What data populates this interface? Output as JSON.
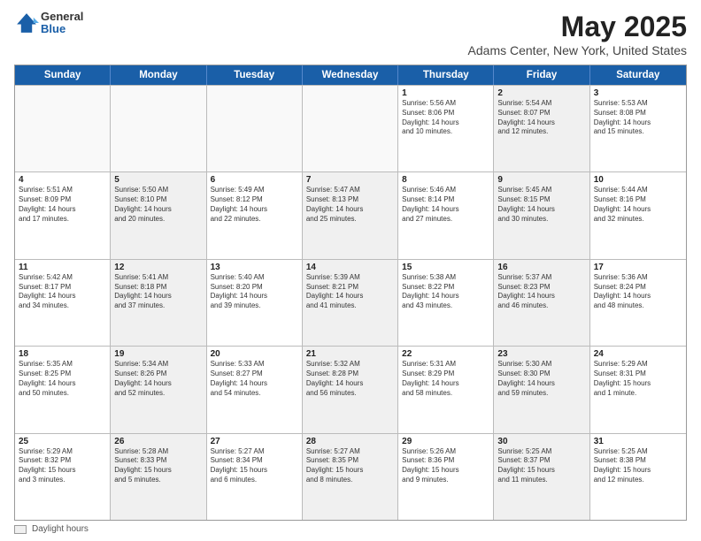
{
  "logo": {
    "general": "General",
    "blue": "Blue"
  },
  "title": "May 2025",
  "subtitle": "Adams Center, New York, United States",
  "days_of_week": [
    "Sunday",
    "Monday",
    "Tuesday",
    "Wednesday",
    "Thursday",
    "Friday",
    "Saturday"
  ],
  "weeks": [
    [
      {
        "day": "",
        "info": "",
        "empty": true
      },
      {
        "day": "",
        "info": "",
        "empty": true
      },
      {
        "day": "",
        "info": "",
        "empty": true
      },
      {
        "day": "",
        "info": "",
        "empty": true
      },
      {
        "day": "1",
        "info": "Sunrise: 5:56 AM\nSunset: 8:06 PM\nDaylight: 14 hours\nand 10 minutes."
      },
      {
        "day": "2",
        "info": "Sunrise: 5:54 AM\nSunset: 8:07 PM\nDaylight: 14 hours\nand 12 minutes.",
        "shaded": true
      },
      {
        "day": "3",
        "info": "Sunrise: 5:53 AM\nSunset: 8:08 PM\nDaylight: 14 hours\nand 15 minutes."
      }
    ],
    [
      {
        "day": "4",
        "info": "Sunrise: 5:51 AM\nSunset: 8:09 PM\nDaylight: 14 hours\nand 17 minutes."
      },
      {
        "day": "5",
        "info": "Sunrise: 5:50 AM\nSunset: 8:10 PM\nDaylight: 14 hours\nand 20 minutes.",
        "shaded": true
      },
      {
        "day": "6",
        "info": "Sunrise: 5:49 AM\nSunset: 8:12 PM\nDaylight: 14 hours\nand 22 minutes."
      },
      {
        "day": "7",
        "info": "Sunrise: 5:47 AM\nSunset: 8:13 PM\nDaylight: 14 hours\nand 25 minutes.",
        "shaded": true
      },
      {
        "day": "8",
        "info": "Sunrise: 5:46 AM\nSunset: 8:14 PM\nDaylight: 14 hours\nand 27 minutes."
      },
      {
        "day": "9",
        "info": "Sunrise: 5:45 AM\nSunset: 8:15 PM\nDaylight: 14 hours\nand 30 minutes.",
        "shaded": true
      },
      {
        "day": "10",
        "info": "Sunrise: 5:44 AM\nSunset: 8:16 PM\nDaylight: 14 hours\nand 32 minutes."
      }
    ],
    [
      {
        "day": "11",
        "info": "Sunrise: 5:42 AM\nSunset: 8:17 PM\nDaylight: 14 hours\nand 34 minutes."
      },
      {
        "day": "12",
        "info": "Sunrise: 5:41 AM\nSunset: 8:18 PM\nDaylight: 14 hours\nand 37 minutes.",
        "shaded": true
      },
      {
        "day": "13",
        "info": "Sunrise: 5:40 AM\nSunset: 8:20 PM\nDaylight: 14 hours\nand 39 minutes."
      },
      {
        "day": "14",
        "info": "Sunrise: 5:39 AM\nSunset: 8:21 PM\nDaylight: 14 hours\nand 41 minutes.",
        "shaded": true
      },
      {
        "day": "15",
        "info": "Sunrise: 5:38 AM\nSunset: 8:22 PM\nDaylight: 14 hours\nand 43 minutes."
      },
      {
        "day": "16",
        "info": "Sunrise: 5:37 AM\nSunset: 8:23 PM\nDaylight: 14 hours\nand 46 minutes.",
        "shaded": true
      },
      {
        "day": "17",
        "info": "Sunrise: 5:36 AM\nSunset: 8:24 PM\nDaylight: 14 hours\nand 48 minutes."
      }
    ],
    [
      {
        "day": "18",
        "info": "Sunrise: 5:35 AM\nSunset: 8:25 PM\nDaylight: 14 hours\nand 50 minutes."
      },
      {
        "day": "19",
        "info": "Sunrise: 5:34 AM\nSunset: 8:26 PM\nDaylight: 14 hours\nand 52 minutes.",
        "shaded": true
      },
      {
        "day": "20",
        "info": "Sunrise: 5:33 AM\nSunset: 8:27 PM\nDaylight: 14 hours\nand 54 minutes."
      },
      {
        "day": "21",
        "info": "Sunrise: 5:32 AM\nSunset: 8:28 PM\nDaylight: 14 hours\nand 56 minutes.",
        "shaded": true
      },
      {
        "day": "22",
        "info": "Sunrise: 5:31 AM\nSunset: 8:29 PM\nDaylight: 14 hours\nand 58 minutes."
      },
      {
        "day": "23",
        "info": "Sunrise: 5:30 AM\nSunset: 8:30 PM\nDaylight: 14 hours\nand 59 minutes.",
        "shaded": true
      },
      {
        "day": "24",
        "info": "Sunrise: 5:29 AM\nSunset: 8:31 PM\nDaylight: 15 hours\nand 1 minute."
      }
    ],
    [
      {
        "day": "25",
        "info": "Sunrise: 5:29 AM\nSunset: 8:32 PM\nDaylight: 15 hours\nand 3 minutes."
      },
      {
        "day": "26",
        "info": "Sunrise: 5:28 AM\nSunset: 8:33 PM\nDaylight: 15 hours\nand 5 minutes.",
        "shaded": true
      },
      {
        "day": "27",
        "info": "Sunrise: 5:27 AM\nSunset: 8:34 PM\nDaylight: 15 hours\nand 6 minutes."
      },
      {
        "day": "28",
        "info": "Sunrise: 5:27 AM\nSunset: 8:35 PM\nDaylight: 15 hours\nand 8 minutes.",
        "shaded": true
      },
      {
        "day": "29",
        "info": "Sunrise: 5:26 AM\nSunset: 8:36 PM\nDaylight: 15 hours\nand 9 minutes."
      },
      {
        "day": "30",
        "info": "Sunrise: 5:25 AM\nSunset: 8:37 PM\nDaylight: 15 hours\nand 11 minutes.",
        "shaded": true
      },
      {
        "day": "31",
        "info": "Sunrise: 5:25 AM\nSunset: 8:38 PM\nDaylight: 15 hours\nand 12 minutes."
      }
    ]
  ],
  "footer": {
    "box_label": "Daylight hours"
  }
}
